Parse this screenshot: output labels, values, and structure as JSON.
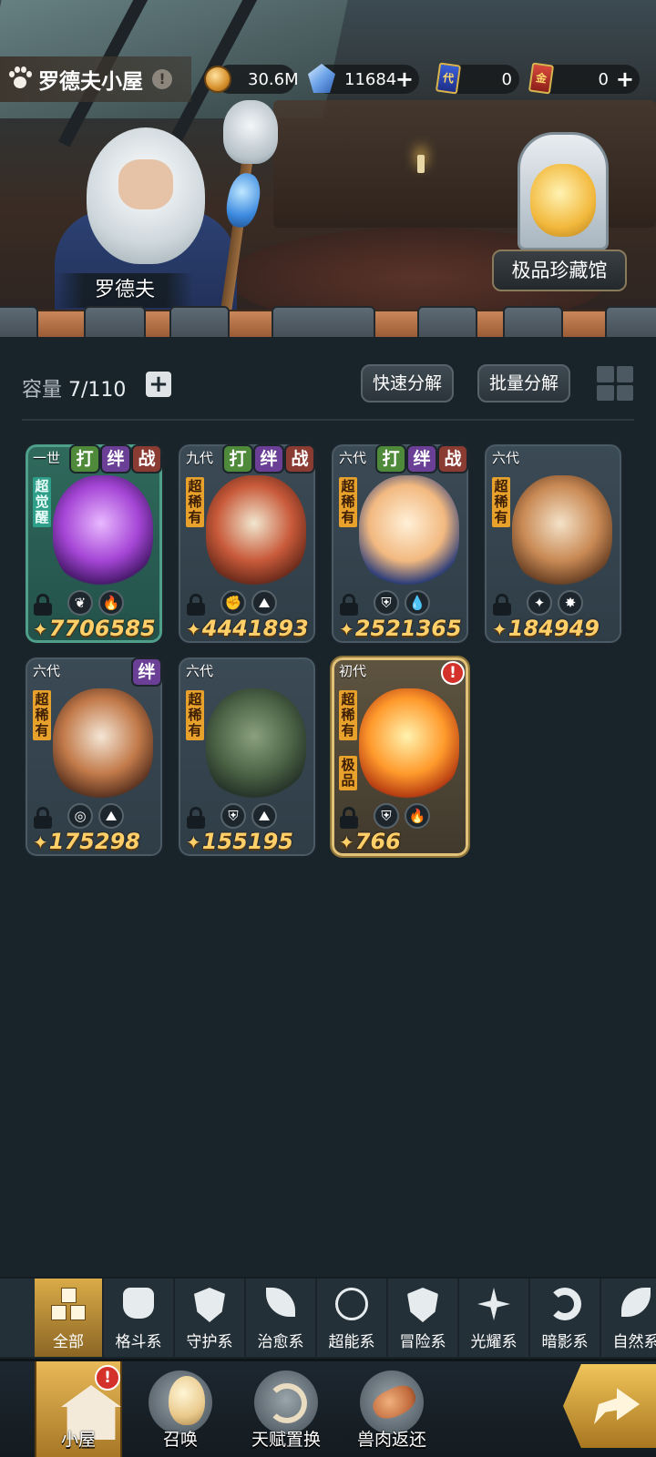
{
  "header": {
    "title": "罗德夫小屋",
    "info_icon": "!",
    "resources": [
      {
        "icon": "coin-icon",
        "value": "30.6M",
        "has_plus": false
      },
      {
        "icon": "crystal-icon",
        "value": "11684",
        "has_plus": true
      },
      {
        "icon": "blue-card-icon",
        "icon_text": "代",
        "value": "0",
        "has_plus": false
      },
      {
        "icon": "red-card-icon",
        "icon_text": "金",
        "value": "0",
        "has_plus": true
      }
    ]
  },
  "scene": {
    "npc_name": "罗德夫",
    "museum_button": "极品珍藏馆"
  },
  "storage": {
    "capacity_label": "容量",
    "capacity_value": "7/110",
    "add_symbol": "+",
    "quick_decompose": "快速分解",
    "batch_decompose": "批量分解"
  },
  "tag_labels": {
    "fight": "打",
    "bond": "绊",
    "war": "战"
  },
  "pets": [
    {
      "generation": "一世",
      "rarity": "超觉醒",
      "rarity_color": "teal",
      "tags": [
        "fight",
        "bond",
        "war"
      ],
      "elements": [
        "leaf-icon",
        "fire-icon"
      ],
      "element_glyphs": [
        "❦",
        "🔥"
      ],
      "power": "7706585",
      "frame": "green",
      "alert": false,
      "art_colors": [
        "#e9b8ff",
        "#a546d6",
        "#4a1a6e"
      ]
    },
    {
      "generation": "九代",
      "rarity": "超稀有",
      "rarity_color": "gold",
      "tags": [
        "fight",
        "bond",
        "war"
      ],
      "elements": [
        "fist-icon",
        "earth-icon"
      ],
      "element_glyphs": [
        "✊",
        "⛰"
      ],
      "power": "4441893",
      "frame": "normal",
      "alert": false,
      "art_colors": [
        "#f1e7cf",
        "#c85a3a",
        "#6e2c1c"
      ]
    },
    {
      "generation": "六代",
      "rarity": "超稀有",
      "rarity_color": "gold",
      "tags": [
        "fight",
        "bond",
        "war"
      ],
      "elements": [
        "shield-icon",
        "water-icon"
      ],
      "element_glyphs": [
        "⛨",
        "💧"
      ],
      "power": "2521365",
      "frame": "normal",
      "alert": false,
      "art_colors": [
        "#fff0d8",
        "#f2b980",
        "#2f3f7a"
      ]
    },
    {
      "generation": "六代",
      "rarity": "超稀有",
      "rarity_color": "gold",
      "tags": [],
      "elements": [
        "sparkle-icon",
        "star-icon"
      ],
      "element_glyphs": [
        "✦",
        "✸"
      ],
      "power": "184949",
      "frame": "normal",
      "alert": false,
      "art_colors": [
        "#f4e2c8",
        "#c98a55",
        "#6d4326"
      ]
    },
    {
      "generation": "六代",
      "rarity": "超稀有",
      "rarity_color": "gold",
      "tags": [
        "bond"
      ],
      "elements": [
        "psychic-icon",
        "earth-icon"
      ],
      "element_glyphs": [
        "◎",
        "⛰"
      ],
      "power": "175298",
      "frame": "normal",
      "alert": false,
      "art_colors": [
        "#f4e6d6",
        "#c27a4a",
        "#5e3521"
      ]
    },
    {
      "generation": "六代",
      "rarity": "超稀有",
      "rarity_color": "gold",
      "tags": [],
      "elements": [
        "shield-icon",
        "earth-icon"
      ],
      "element_glyphs": [
        "⛨",
        "⛰"
      ],
      "power": "155195",
      "frame": "normal",
      "alert": false,
      "art_colors": [
        "#8aa07e",
        "#4d6446",
        "#27352a"
      ]
    },
    {
      "generation": "初代",
      "rarity": "超稀有",
      "rarity_color": "gold",
      "extra_tag": "极品",
      "tags": [],
      "elements": [
        "shield-icon",
        "fire-icon"
      ],
      "element_glyphs": [
        "⛨",
        "🔥"
      ],
      "power": "766",
      "frame": "gold",
      "alert": true,
      "alert_text": "!",
      "art_colors": [
        "#fff3b0",
        "#ff9a2c",
        "#b73d12"
      ]
    }
  ],
  "filters": [
    {
      "label": "全部",
      "icon": "all-squares-icon",
      "active": true
    },
    {
      "label": "格斗系",
      "icon": "fist-icon",
      "active": false
    },
    {
      "label": "守护系",
      "icon": "shield-icon",
      "active": false
    },
    {
      "label": "治愈系",
      "icon": "leaf-icon",
      "active": false
    },
    {
      "label": "超能系",
      "icon": "psychic-icon",
      "active": false
    },
    {
      "label": "冒险系",
      "icon": "adventure-icon",
      "active": false
    },
    {
      "label": "光耀系",
      "icon": "light-icon",
      "active": false
    },
    {
      "label": "暗影系",
      "icon": "shadow-icon",
      "active": false
    },
    {
      "label": "自然系",
      "icon": "nature-icon",
      "active": false
    }
  ],
  "nav": [
    {
      "label": "小屋",
      "icon": "house-icon",
      "active": true,
      "alert": "!"
    },
    {
      "label": "召唤",
      "icon": "egg-icon",
      "active": false
    },
    {
      "label": "天赋置换",
      "icon": "swap-icon",
      "active": false
    },
    {
      "label": "兽肉返还",
      "icon": "meat-icon",
      "active": false
    }
  ],
  "colors": {
    "background": "#19232a",
    "accent_gold": "#e8b957",
    "power_text": "#ffcf6a",
    "rarity_gold": "#e8a22c"
  }
}
